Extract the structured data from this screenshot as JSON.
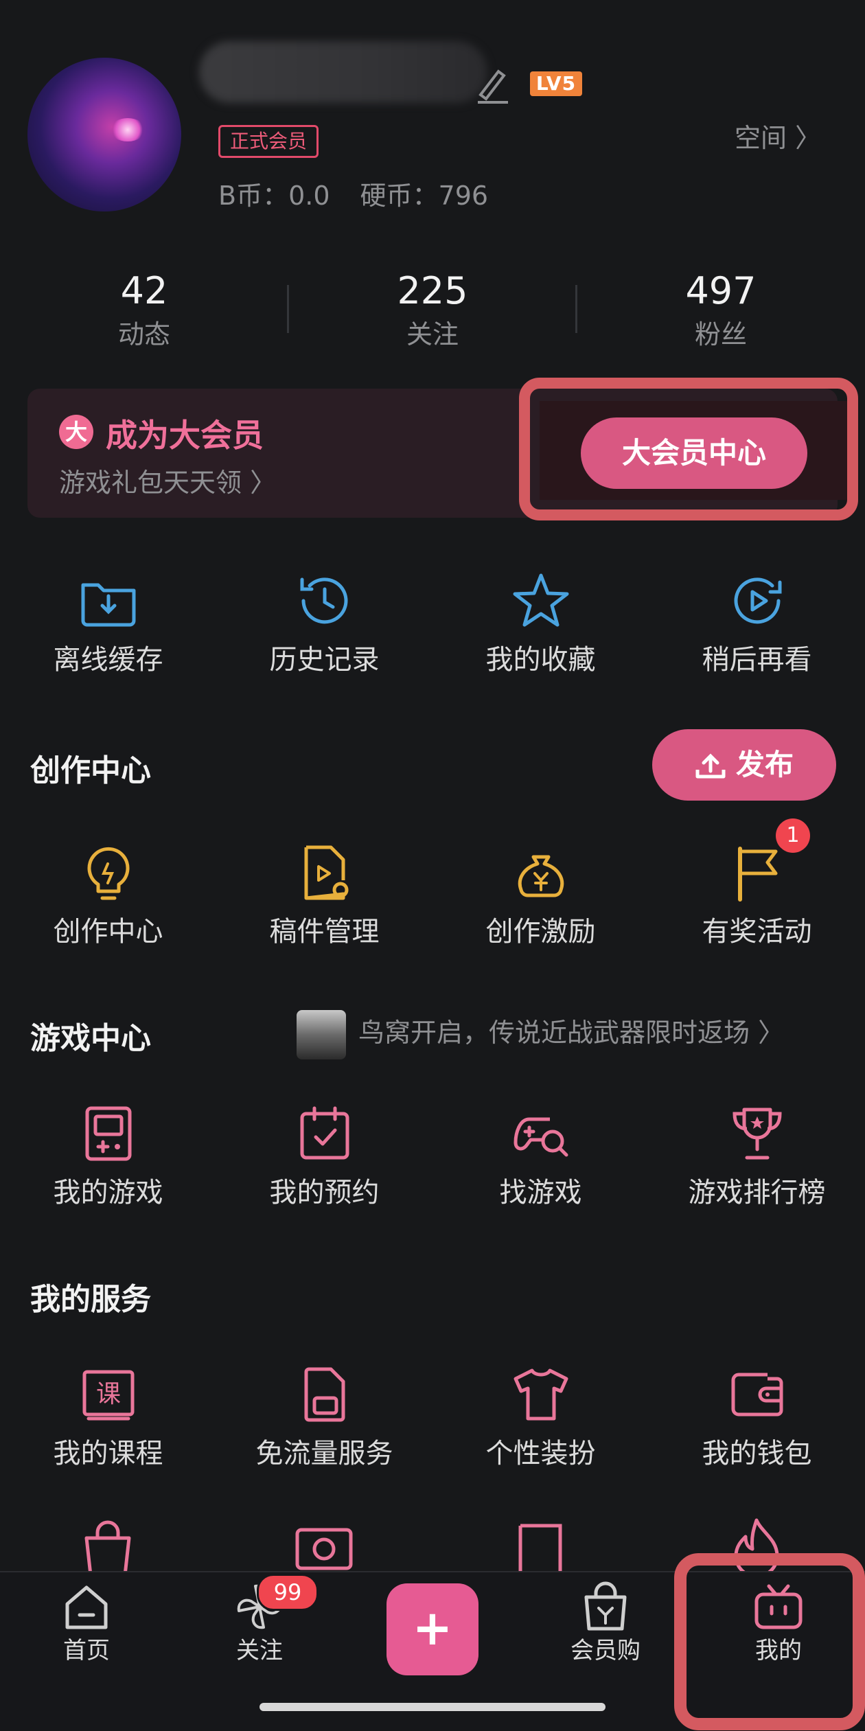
{
  "profile": {
    "level": "LV5",
    "member_tag": "正式会员",
    "b_coin": "B币：0.0",
    "hard_coin": "硬币：796",
    "space_link": "空间 〉"
  },
  "stats": [
    {
      "num": "42",
      "label": "动态"
    },
    {
      "num": "225",
      "label": "关注"
    },
    {
      "num": "497",
      "label": "粉丝"
    }
  ],
  "vip": {
    "badge": "大",
    "title": "成为大会员",
    "subtitle": "游戏礼包天天领 〉",
    "center_button": "大会员中心"
  },
  "quick": [
    {
      "label": "离线缓存",
      "icon": "download-folder-icon"
    },
    {
      "label": "历史记录",
      "icon": "history-clock-icon"
    },
    {
      "label": "我的收藏",
      "icon": "star-icon"
    },
    {
      "label": "稍后再看",
      "icon": "watch-later-icon"
    }
  ],
  "creation": {
    "title": "创作中心",
    "publish_button": "发布",
    "items": [
      {
        "label": "创作中心",
        "icon": "lightbulb-icon"
      },
      {
        "label": "稿件管理",
        "icon": "manuscript-icon"
      },
      {
        "label": "创作激励",
        "icon": "money-bag-icon"
      },
      {
        "label": "有奖活动",
        "icon": "flag-icon",
        "badge": "1"
      }
    ]
  },
  "games": {
    "title": "游戏中心",
    "promo": "鸟窝开启，传说近战武器限时返场 〉",
    "items": [
      {
        "label": "我的游戏",
        "icon": "gameboy-icon"
      },
      {
        "label": "我的预约",
        "icon": "calendar-check-icon"
      },
      {
        "label": "找游戏",
        "icon": "gamepad-search-icon"
      },
      {
        "label": "游戏排行榜",
        "icon": "trophy-icon"
      }
    ]
  },
  "services": {
    "title": "我的服务",
    "items": [
      {
        "label": "我的课程",
        "icon": "course-icon",
        "glyph": "课"
      },
      {
        "label": "免流量服务",
        "icon": "sim-card-icon"
      },
      {
        "label": "个性装扮",
        "icon": "tshirt-icon"
      },
      {
        "label": "我的钱包",
        "icon": "wallet-icon"
      }
    ]
  },
  "tabbar": {
    "home": "首页",
    "follow": "关注",
    "follow_badge": "99",
    "plus": "+",
    "vip_shop": "会员购",
    "mine": "我的"
  },
  "colors": {
    "accent": "#d95882",
    "pink_text": "#e9769a",
    "highlight": "#d45a60",
    "background": "#17181a"
  }
}
